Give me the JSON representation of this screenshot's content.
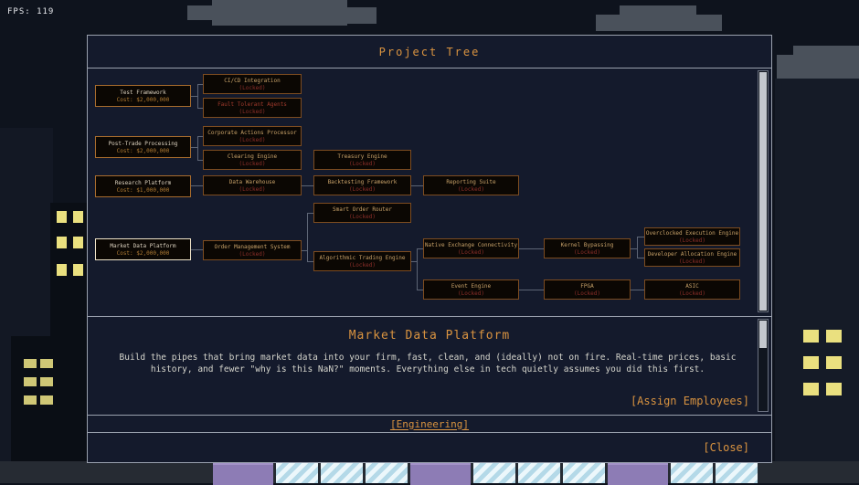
{
  "hud": {
    "fps_label": "FPS: 119"
  },
  "dialog": {
    "title": "Project Tree",
    "detail": {
      "title": "Market Data Platform",
      "description": "Build the pipes that bring market data into your firm, fast, clean, and (ideally) not on fire. Real-time prices, basic history, and fewer \"why is this NaN?\" moments. Everything else in tech quietly assumes you did this first.",
      "assign_button": "[Assign Employees]"
    },
    "tab_label": "[Engineering]",
    "close_button": "[Close]"
  },
  "tree": {
    "nodes": [
      {
        "title": "Test Framework",
        "subtitle": "Cost: $2,000,000",
        "state": "available"
      },
      {
        "title": "Post-Trade Processing",
        "subtitle": "Cost: $2,000,000",
        "state": "available"
      },
      {
        "title": "Research Platform",
        "subtitle": "Cost: $1,000,000",
        "state": "available"
      },
      {
        "title": "Market Data Platform",
        "subtitle": "Cost: $2,000,000",
        "state": "selected"
      },
      {
        "title": "CI/CD Integration",
        "subtitle": "(Locked)",
        "state": "locked"
      },
      {
        "title": "Fault Tolerant Agents",
        "subtitle": "(Locked)",
        "state": "locked"
      },
      {
        "title": "Corporate Actions Processor",
        "subtitle": "(Locked)",
        "state": "locked"
      },
      {
        "title": "Clearing Engine",
        "subtitle": "(Locked)",
        "state": "locked"
      },
      {
        "title": "Data Warehouse",
        "subtitle": "(Locked)",
        "state": "locked"
      },
      {
        "title": "Order Management System",
        "subtitle": "(Locked)",
        "state": "locked"
      },
      {
        "title": "Treasury Engine",
        "subtitle": "(Locked)",
        "state": "locked"
      },
      {
        "title": "Backtesting Framework",
        "subtitle": "(Locked)",
        "state": "locked"
      },
      {
        "title": "Smart Order Router",
        "subtitle": "(Locked)",
        "state": "locked"
      },
      {
        "title": "Algorithmic Trading Engine",
        "subtitle": "(Locked)",
        "state": "locked"
      },
      {
        "title": "Reporting Suite",
        "subtitle": "(Locked)",
        "state": "locked"
      },
      {
        "title": "Native Exchange Connectivity",
        "subtitle": "(Locked)",
        "state": "locked"
      },
      {
        "title": "Event Engine",
        "subtitle": "(Locked)",
        "state": "locked"
      },
      {
        "title": "Kernel Bypassing",
        "subtitle": "(Locked)",
        "state": "locked"
      },
      {
        "title": "FPGA",
        "subtitle": "(Locked)",
        "state": "locked"
      },
      {
        "title": "Overclocked Execution Engine",
        "subtitle": "(Locked)",
        "state": "locked"
      },
      {
        "title": "Developer Allocation Engine",
        "subtitle": "(Locked)",
        "state": "locked"
      },
      {
        "title": "ASIC",
        "subtitle": "(Locked)",
        "state": "locked"
      }
    ]
  },
  "colors": {
    "accent_orange": "#d99340",
    "locked_red": "#8c2f2a",
    "node_border": "#7d4c20",
    "selected_border": "#efe3c8",
    "dialog_bg": "#141a2c",
    "dialog_border": "#9aa1ae",
    "window_yellow": "#eae07f",
    "tile_purple": "#8d7cb5",
    "tile_cyan": "#b4d9e8",
    "connector_gray": "#5d6575"
  }
}
